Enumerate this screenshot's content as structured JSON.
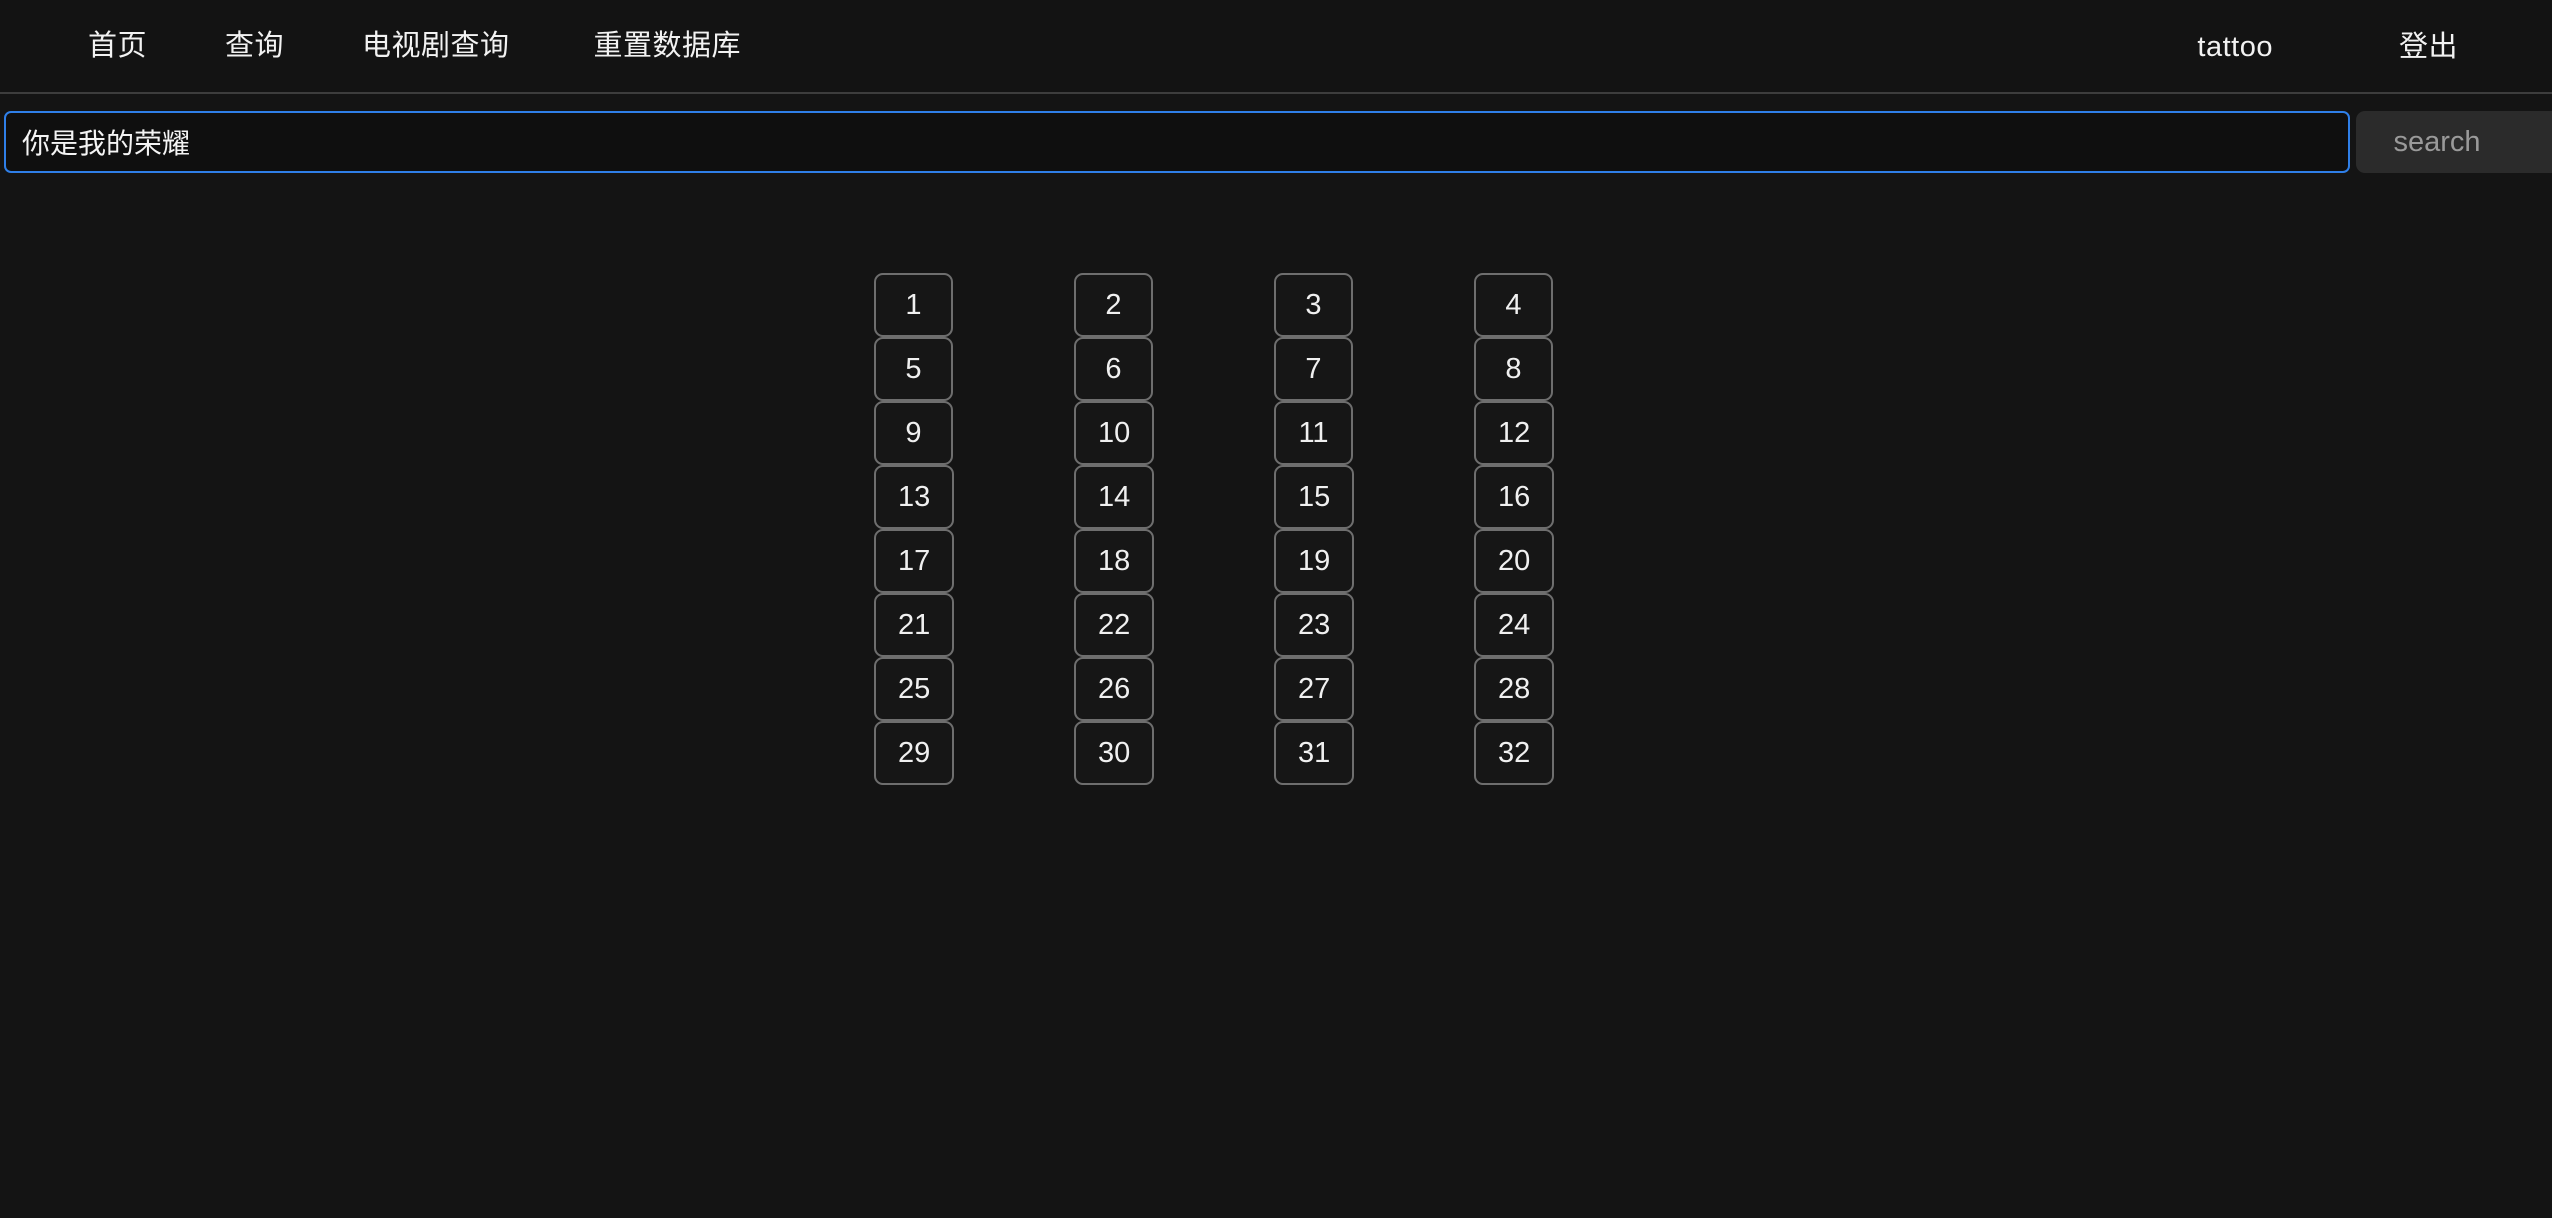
{
  "navbar": {
    "links": [
      {
        "label": "首页",
        "name": "nav-link-home"
      },
      {
        "label": "查询",
        "name": "nav-link-query"
      },
      {
        "label": "电视剧查询",
        "name": "nav-link-tv"
      },
      {
        "label": "重置数据库",
        "name": "nav-link-reset"
      }
    ],
    "user": "tattoo",
    "logout": "登出"
  },
  "search": {
    "value": "你是我的荣耀",
    "placeholder": "",
    "button_label": "search"
  },
  "pagination": {
    "columns": 4,
    "rows": 8,
    "pages": [
      "1",
      "2",
      "3",
      "4",
      "5",
      "6",
      "7",
      "8",
      "9",
      "10",
      "11",
      "12",
      "13",
      "14",
      "15",
      "16",
      "17",
      "18",
      "19",
      "20",
      "21",
      "22",
      "23",
      "24",
      "25",
      "26",
      "27",
      "28",
      "29",
      "30",
      "31",
      "32"
    ]
  },
  "colors": {
    "background": "#141414",
    "navbar": "#131313",
    "focus_ring": "#2f7fe8",
    "button_border": "#6e6e6e",
    "button_fill": "#161616",
    "search_button_fill": "#2b2b2b",
    "search_button_text": "#9a9a9a",
    "text": "#f2f2f2"
  }
}
